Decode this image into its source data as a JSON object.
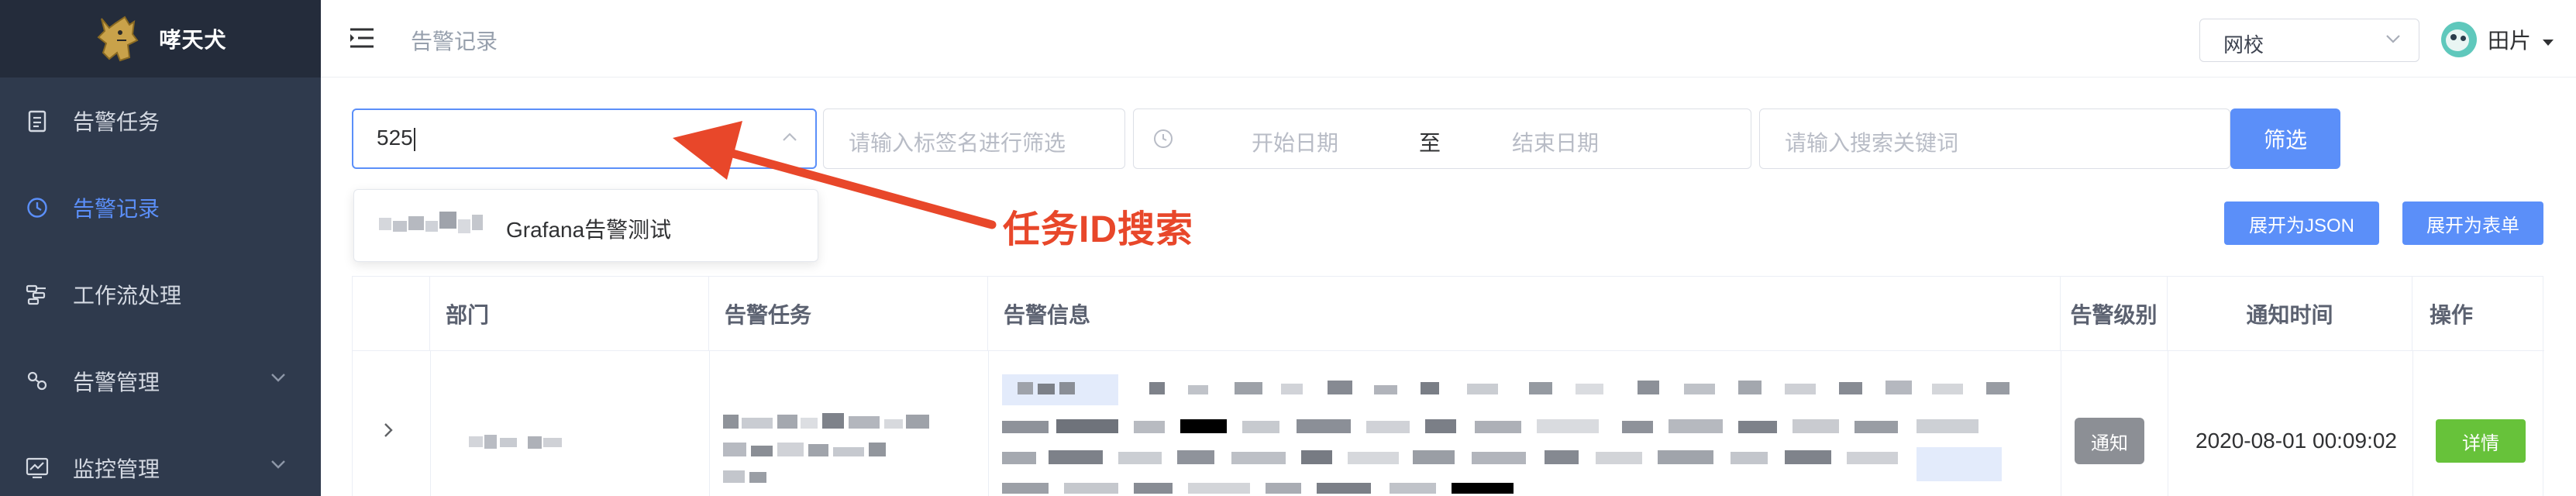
{
  "app": {
    "name": "哮天犬"
  },
  "sidebar": {
    "items": [
      {
        "label": "告警任务",
        "icon": "clipboard-icon",
        "active": false,
        "has_submenu": false
      },
      {
        "label": "告警记录",
        "icon": "clock-icon",
        "active": true,
        "has_submenu": false
      },
      {
        "label": "工作流处理",
        "icon": "workflow-icon",
        "active": false,
        "has_submenu": false
      },
      {
        "label": "告警管理",
        "icon": "gear-nodes-icon",
        "active": false,
        "has_submenu": true
      },
      {
        "label": "监控管理",
        "icon": "monitor-chart-icon",
        "active": false,
        "has_submenu": true
      }
    ]
  },
  "header": {
    "breadcrumb": "告警记录",
    "school_select": "网校",
    "user_name": "田片"
  },
  "filters": {
    "task_value": "525",
    "tag_placeholder": "请输入标签名进行筛选",
    "start_placeholder": "开始日期",
    "range_separator": "至",
    "end_placeholder": "结束日期",
    "keyword_placeholder": "请输入搜索关键词",
    "filter_button": "筛选"
  },
  "dropdown": {
    "option_label": "Grafana告警测试"
  },
  "annotation": {
    "text": "任务ID搜索"
  },
  "actions": {
    "expand_json": "展开为JSON",
    "expand_form": "展开为表单"
  },
  "table": {
    "columns": [
      "部门",
      "告警任务",
      "告警信息",
      "告警级别",
      "通知时间",
      "操作"
    ],
    "rows": [
      {
        "level": "通知",
        "time": "2020-08-01 00:09:02",
        "action": "详情"
      }
    ]
  },
  "colors": {
    "sidebar_bg": "#2f3a4d",
    "brand_bg": "#242c3b",
    "accent": "#5b8ff9",
    "annotation_red": "#e8472a",
    "success": "#67c23a",
    "badge_gray": "#8c8f95"
  }
}
